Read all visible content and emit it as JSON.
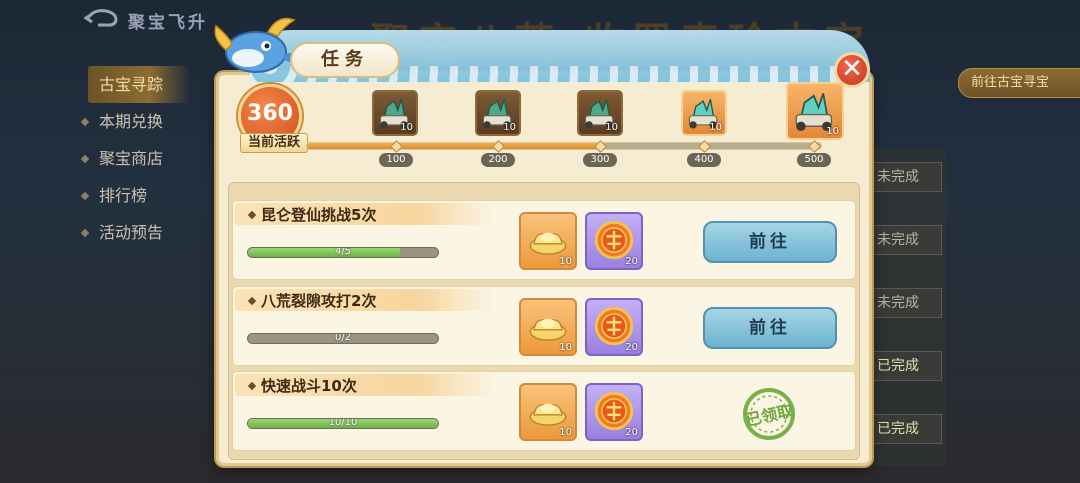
{
  "background": {
    "app_title": "聚宝飞升",
    "banner_title": "聚宝八荒 收罗奇珍古宝",
    "nav": [
      {
        "label": "古宝寻踪",
        "active": true
      },
      {
        "label": "本期兑换",
        "active": false
      },
      {
        "label": "聚宝商店",
        "active": false
      },
      {
        "label": "排行榜",
        "active": false
      },
      {
        "label": "活动预告",
        "active": false
      }
    ],
    "right_button": "前往古宝寻宝",
    "statuses": [
      "未完成",
      "未完成",
      "未完成",
      "已完成",
      "已完成"
    ]
  },
  "modal": {
    "title": "任务",
    "close_symbol": "✕",
    "activity": {
      "value": "360",
      "label": "当前活跃",
      "max": 500
    },
    "milestones": [
      {
        "label": "100",
        "count": "10",
        "lit": false
      },
      {
        "label": "200",
        "count": "10",
        "lit": false
      },
      {
        "label": "300",
        "count": "10",
        "lit": false
      },
      {
        "label": "400",
        "count": "10",
        "lit": true
      },
      {
        "label": "500",
        "count": "10",
        "lit": true
      }
    ],
    "tasks": [
      {
        "title": "昆仑登仙挑战5次",
        "progress_text": "4/5",
        "progress": 0.8,
        "rewards": [
          {
            "type": "gold-ingot",
            "count": "10"
          },
          {
            "type": "treasure-token",
            "count": "20"
          }
        ],
        "action": "前往",
        "claimed": false
      },
      {
        "title": "八荒裂隙攻打2次",
        "progress_text": "0/2",
        "progress": 0,
        "rewards": [
          {
            "type": "gold-ingot",
            "count": "10"
          },
          {
            "type": "treasure-token",
            "count": "20"
          }
        ],
        "action": "前往",
        "claimed": false
      },
      {
        "title": "快速战斗10次",
        "progress_text": "10/10",
        "progress": 1,
        "rewards": [
          {
            "type": "gold-ingot",
            "count": "10"
          },
          {
            "type": "treasure-token",
            "count": "20"
          }
        ],
        "action": "已领取",
        "claimed": true
      }
    ]
  },
  "colors": {
    "modal_bg": "#f5ecd2",
    "accent_orange": "#de8a2b",
    "go_button": "#6cb3cf",
    "progress_green": "#6fb24a"
  },
  "icons": {
    "back": "back-arrow-icon",
    "close": "close-icon",
    "chest": "jade-chest-icon",
    "gold": "gold-ingot-icon",
    "token": "treasure-token-icon",
    "stamp": "claimed-stamp-icon"
  }
}
